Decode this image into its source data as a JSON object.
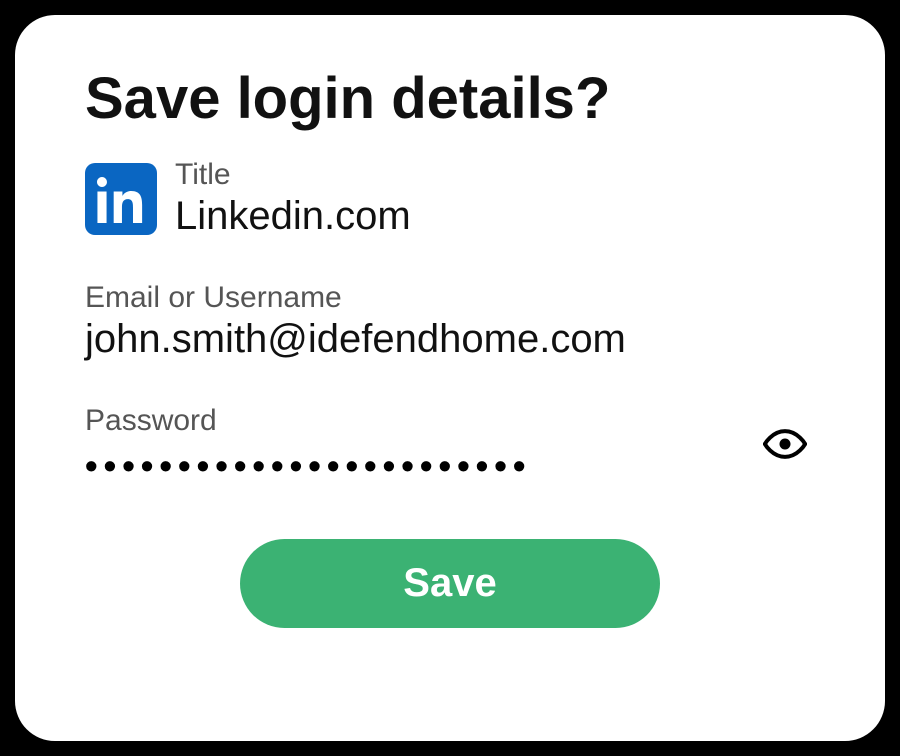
{
  "heading": "Save login details?",
  "site": {
    "icon": "linkedin-icon",
    "title_label": "Title",
    "title_value": "Linkedin.com"
  },
  "username": {
    "label": "Email or Username",
    "value": "john.smith@idefendhome.com"
  },
  "password": {
    "label": "Password",
    "masked": "••••••••••••••••••••••••"
  },
  "actions": {
    "save_label": "Save"
  },
  "colors": {
    "brand_linkedin": "#0a66c2",
    "button_green": "#3bb273"
  }
}
